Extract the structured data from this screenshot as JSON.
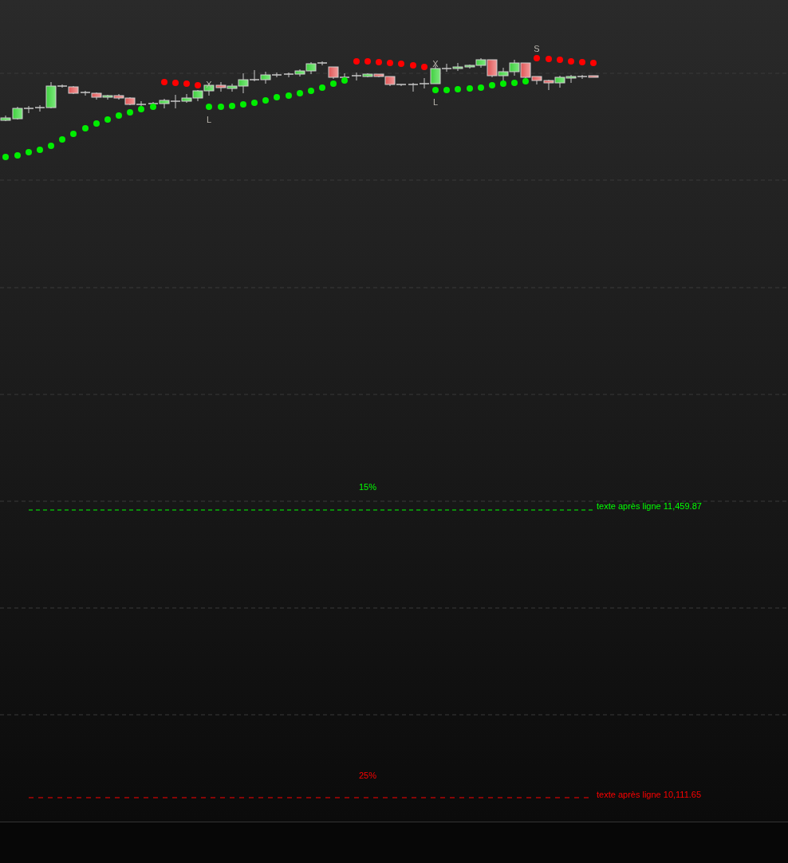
{
  "markers": [
    {
      "text": "X"
    },
    {
      "text": "L"
    },
    {
      "text": "X"
    },
    {
      "text": "L"
    },
    {
      "text": "S"
    }
  ],
  "levels": [
    {
      "percent": "15%",
      "label": "texte après ligne 11,459.87",
      "color": "#00ff00"
    },
    {
      "percent": "25%",
      "label": "texte après ligne 10,111.65",
      "color": "#ff0000"
    }
  ]
}
